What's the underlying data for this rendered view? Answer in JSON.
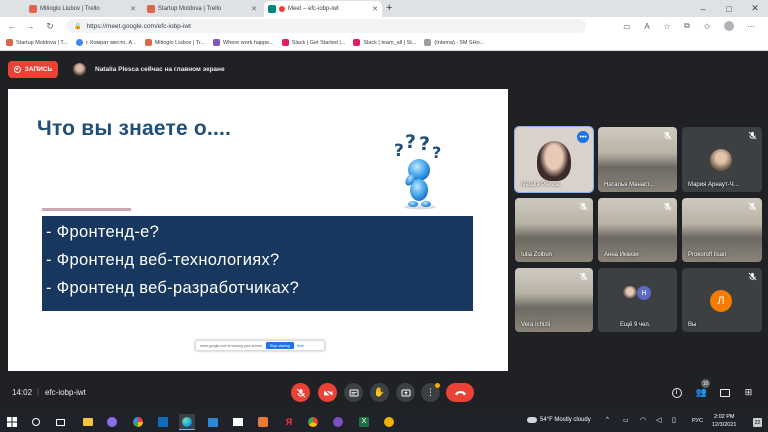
{
  "browser": {
    "tabs": [
      {
        "title": "Mitioglo Liubov | Trello",
        "color": "#e0664b"
      },
      {
        "title": "Startup Moldova | Trello",
        "color": "#e0664b"
      },
      {
        "title": "Meet – efc-iobp-iwt",
        "color": "#00897b"
      }
    ],
    "url": "https://meet.google.com/efc-iobp-iwt",
    "bookmarks": [
      {
        "label": "Startup Moldova | T...",
        "color": "#e0664b"
      },
      {
        "label": "г. Комрат место, А...",
        "color": "#4285f4"
      },
      {
        "label": "Mitioglo Liubov | Tr...",
        "color": "#e0664b"
      },
      {
        "label": "Where work happe...",
        "color": "#7e57c2"
      },
      {
        "label": "Slack | Get Started |...",
        "color": "#e01e5a"
      },
      {
        "label": "Slack | team_all | St...",
        "color": "#e01e5a"
      },
      {
        "label": "(Intema) - 5M SHo...",
        "color": "#9e9e9e"
      }
    ]
  },
  "meet": {
    "record_label": "ЗАПИСЬ",
    "presenter_status": "Natalia Plesca сейчас на главном экране",
    "meeting_time": "14:02",
    "meeting_code": "efc-iobp-iwt",
    "people_count": "10"
  },
  "slide": {
    "title": "Что вы знаете о....",
    "bullets": [
      "- Фронтенд-е?",
      "- Фронтенд веб-технологиях?",
      "- Фронтенд веб-разработчиках?"
    ],
    "share_text": "meet.google.com is sharing your screen.",
    "stop_sharing": "Stop sharing",
    "hide": "Hide"
  },
  "participants": [
    {
      "name": "Natalia Plesca",
      "kind": "speaker"
    },
    {
      "name": "Наталья Манаст...",
      "kind": "classroom"
    },
    {
      "name": "Мария Арнаут-Ч...",
      "kind": "avatar"
    },
    {
      "name": "Iulia Zolbun",
      "kind": "classroom"
    },
    {
      "name": "Анна Иккизи",
      "kind": "classroom"
    },
    {
      "name": "Prokorofl Iisan",
      "kind": "classroom"
    },
    {
      "name": "Vera Ichizli",
      "kind": "classroom"
    },
    {
      "name": "Ещё 9 чел.",
      "kind": "others",
      "letter": "Н"
    },
    {
      "name": "Вы",
      "kind": "self",
      "letter": "Л"
    }
  ],
  "taskbar": {
    "weather": "54°F  Mostly cloudy",
    "language": "РУС",
    "time": "2:02 PM",
    "date": "12/3/2021",
    "notifications": "22"
  }
}
